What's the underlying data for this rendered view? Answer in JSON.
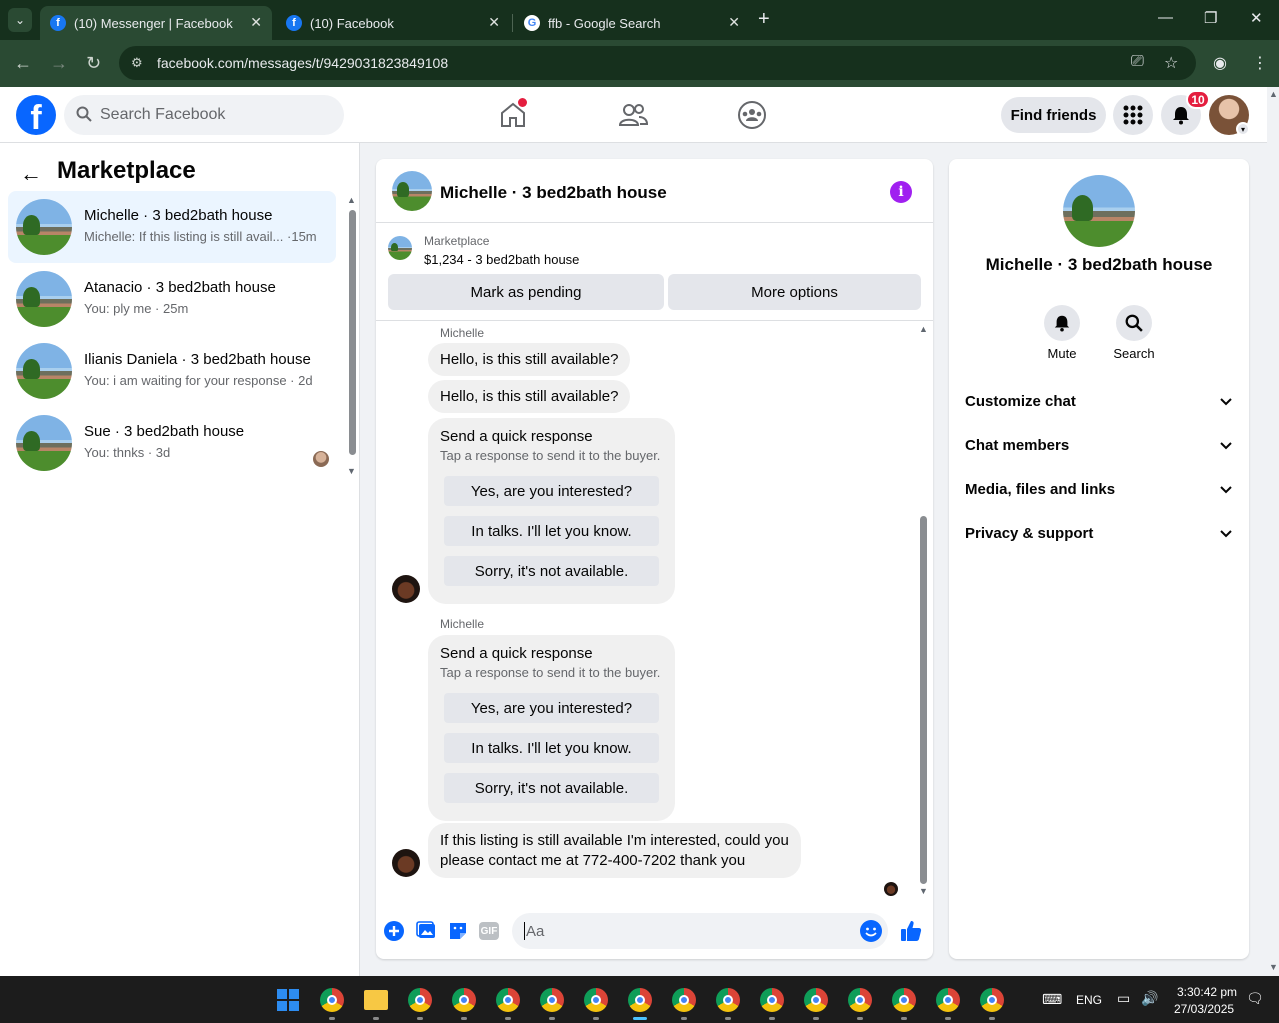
{
  "browser": {
    "tabs": [
      {
        "title": "(10) Messenger | Facebook",
        "icon": "facebook-icon",
        "active": true
      },
      {
        "title": "(10) Facebook",
        "icon": "facebook-icon",
        "active": false
      },
      {
        "title": "ffb - Google Search",
        "icon": "google-icon",
        "active": false
      }
    ],
    "url": "facebook.com/messages/t/9429031823849108"
  },
  "fb_header": {
    "search_placeholder": "Search Facebook",
    "find_friends": "Find friends",
    "notification_count": "10"
  },
  "left_panel": {
    "title": "Marketplace",
    "conversations": [
      {
        "name": "Michelle · 3 bed2bath house",
        "snippet": "Michelle: If this listing is still avail... ·15m",
        "active": true
      },
      {
        "name": "Atanacio · 3 bed2bath house",
        "snippet": "You: ply me · 25m",
        "active": false
      },
      {
        "name": "Ilianis Daniela · 3 bed2bath house",
        "snippet": "You: i am waiting for your response · 2d",
        "active": false
      },
      {
        "name": "Sue · 3 bed2bath house",
        "snippet": "You: thnks · 3d",
        "active": false
      }
    ]
  },
  "chat": {
    "title": "Michelle · 3 bed2bath house",
    "marketplace_label": "Marketplace",
    "listing": "$1,234 - 3 bed2bath house",
    "mark_pending": "Mark as pending",
    "more_options": "More options",
    "sender_name": "Michelle",
    "messages": [
      "Hello, is this still available?",
      "Hello, is this still available?"
    ],
    "quick_response": {
      "title": "Send a quick response",
      "subtitle": "Tap a response to send it to the buyer.",
      "options": [
        "Yes, are you interested?",
        "In talks. I'll let you know.",
        "Sorry, it's not available."
      ]
    },
    "last_message_line1": "If this listing is still available I'm interested, could you",
    "last_message_line2": "please contact me at 772-400-7202 thank you",
    "composer_placeholder": "Aa",
    "gif_label": "GIF"
  },
  "right_panel": {
    "name": "Michelle · 3 bed2bath house",
    "mute": "Mute",
    "search": "Search",
    "sections": [
      "Customize chat",
      "Chat members",
      "Media, files and links",
      "Privacy & support"
    ]
  },
  "taskbar": {
    "language": "ENG",
    "time": "3:30:42 pm",
    "date": "27/03/2025"
  },
  "colors": {
    "facebook_blue": "#0866ff",
    "active_convo_bg": "#ebf5ff",
    "info_purple": "#a020f0",
    "notification_red": "#e41e3f",
    "browser_frame": "#16301d"
  }
}
